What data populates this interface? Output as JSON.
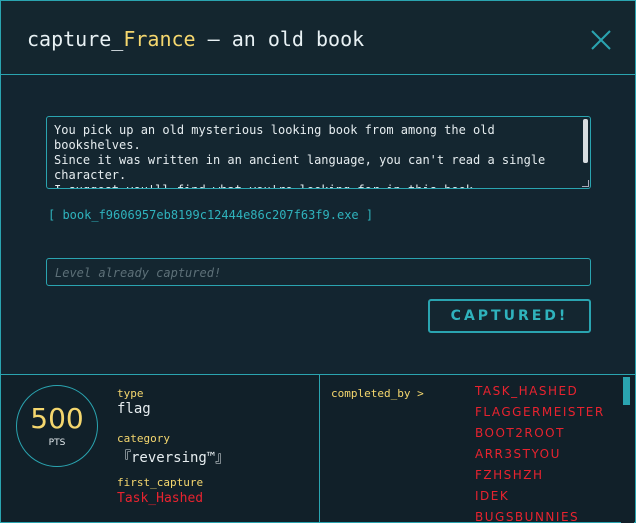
{
  "header": {
    "title_prefix": "capture_",
    "title_accent": "France",
    "title_suffix": " – an old book",
    "close_icon": "close-x-icon"
  },
  "challenge": {
    "description": "You pick up an old mysterious looking book from among the old\nbookshelves.\nSince it was written in an ancient language, you can't read a single\ncharacter.\nI suggest you'll find what you're looking for in this book...",
    "file_link": "[ book_f9606957eb8199c12444e86c207f63f9.exe ]",
    "flag_placeholder": "Level already captured!",
    "captured_button": "CAPTURED!"
  },
  "stats": {
    "points": "500",
    "points_unit": "PTS",
    "type_label": "type",
    "type_value": "flag",
    "category_label": "category",
    "category_value": "『reversing™』",
    "first_capture_label": "first_capture",
    "first_capture_value": "Task_Hashed"
  },
  "completed": {
    "label": "completed_by >",
    "solvers": [
      "TASK_HASHED",
      "FLAGGERMEISTER",
      "BOOT2ROOT",
      "ARR3STYOU",
      "FZHSHZH",
      "IDEK",
      "BUGSBUNNIES"
    ]
  },
  "colors": {
    "accent_teal": "#2aa4b0",
    "accent_yellow": "#f5d76e",
    "solver_red": "#e8232f",
    "background": "#132530"
  }
}
